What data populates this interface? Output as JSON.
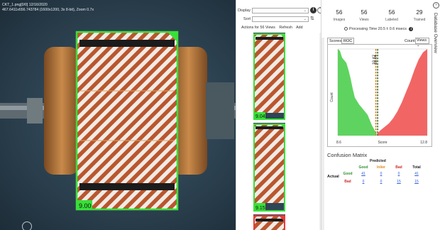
{
  "viewer": {
    "file_line": "CKT_1.png[0/0] 12/16/2020",
    "info_line": "467.6411x656.743784 (1600x1200, 3x 8-bit), Zoom 0.7x",
    "main_score": "9.00"
  },
  "strip": {
    "display_label": "Display",
    "sort_label": "Sort",
    "actions_label": "Actions for 56 Views",
    "refresh_label": "Refresh",
    "add_label": "Add",
    "thumb_scores": [
      "9.04",
      "9.15"
    ]
  },
  "stats": [
    {
      "value": "56",
      "label": "Images"
    },
    {
      "value": "56",
      "label": "Views"
    },
    {
      "value": "56",
      "label": "Labeled"
    },
    {
      "value": "29",
      "label": "Trained"
    }
  ],
  "processing_time": "Processing Time 20.5 ± 0.6 msecs",
  "tabs": [
    "Scores",
    "ROC"
  ],
  "count_label": "Count",
  "count_option": "Views",
  "side_title": "Database Overview",
  "chart_data": {
    "type": "area",
    "ylabel": "Count",
    "xlabel": "Score",
    "xlim": [
      8.6,
      12.8
    ],
    "x_tick_labels": [
      "8.6",
      "12.8"
    ],
    "thresholds": [
      {
        "label": "10.42",
        "x": 10.42,
        "color": "#e07a1a"
      },
      {
        "label": "10.44",
        "x": 10.44,
        "color": "#3a7a3a"
      }
    ],
    "series": [
      {
        "name": "Good",
        "color": "#5fd35f",
        "x": [
          8.6,
          8.7,
          8.8,
          9.0,
          9.1,
          9.2,
          9.3,
          9.4,
          9.6,
          9.8,
          10.0,
          10.2,
          10.42
        ],
        "y": [
          100,
          98,
          90,
          84,
          76,
          66,
          54,
          44,
          36,
          30,
          24,
          12,
          2
        ]
      },
      {
        "name": "Bad",
        "color": "#f26565",
        "x": [
          10.44,
          10.6,
          10.8,
          11.0,
          11.2,
          11.4,
          11.6,
          11.8,
          12.0,
          12.2,
          12.4,
          12.6,
          12.8
        ],
        "y": [
          2,
          6,
          10,
          14,
          20,
          28,
          38,
          50,
          62,
          76,
          88,
          96,
          100
        ]
      }
    ]
  },
  "confusion": {
    "title": "Confusion Matrix",
    "predicted_label": "Predicted",
    "actual_label": "Actual",
    "columns": [
      "Good",
      "Inlier",
      "Bad",
      "Total"
    ],
    "rows": [
      {
        "label": "Good",
        "values": [
          "41",
          "0",
          "0",
          "41"
        ]
      },
      {
        "label": "Bad",
        "values": [
          "0",
          "0",
          "15",
          "15"
        ]
      }
    ],
    "colors": {
      "good": "#2f8f2f",
      "inlier": "#e08a1a",
      "bad": "#d22a2a",
      "link": "#2b5bd8"
    }
  }
}
